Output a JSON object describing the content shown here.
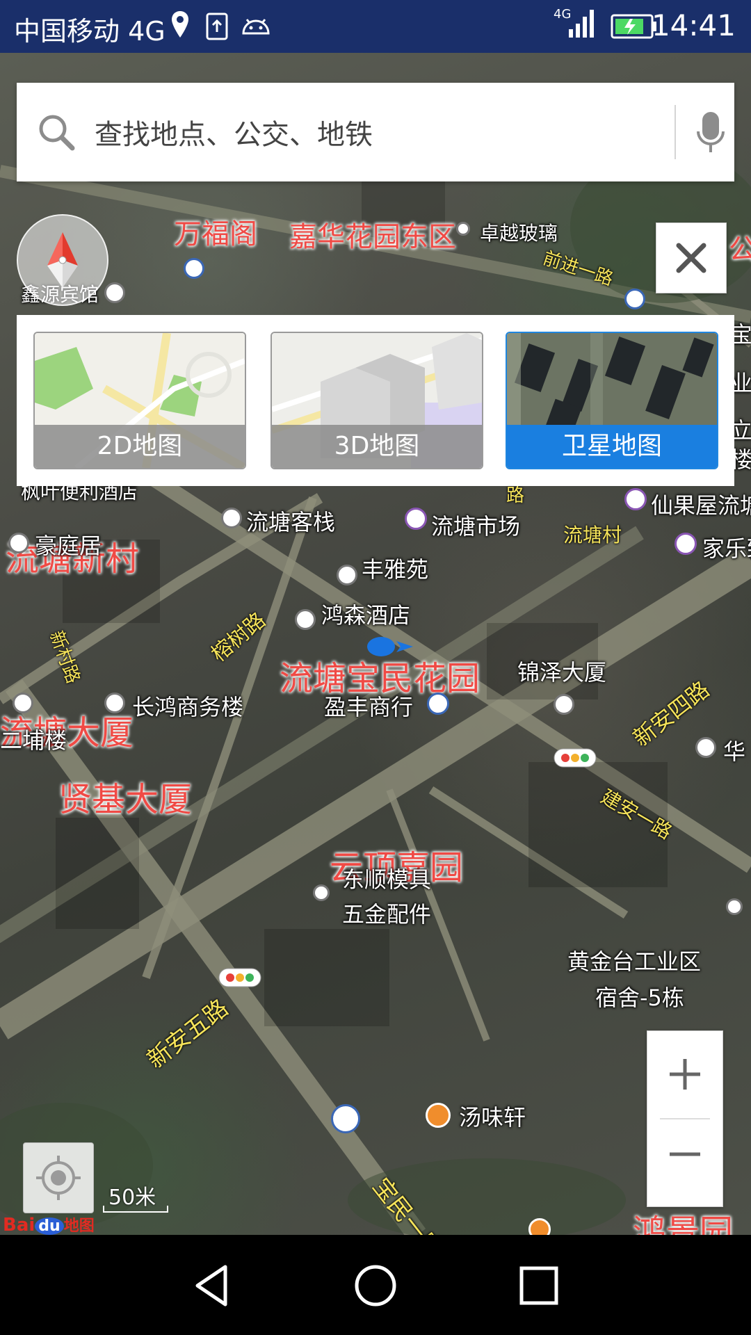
{
  "status_bar": {
    "carrier": "中国移动 4G",
    "network_badge": "4G",
    "time": "14:41",
    "icons": [
      "location-icon",
      "upload-icon",
      "android-icon",
      "signal-icon",
      "battery-icon"
    ]
  },
  "search": {
    "placeholder": "查找地点、公交、地铁",
    "icons": [
      "search-icon",
      "microphone-icon"
    ]
  },
  "layer_panel": {
    "options": [
      {
        "label": "2D地图",
        "selected": false
      },
      {
        "label": "3D地图",
        "selected": false
      },
      {
        "label": "卫星地图",
        "selected": true
      }
    ],
    "accent_color": "#1a7fe0"
  },
  "map": {
    "labels_red_large": [
      "流塘新村",
      "流塘宝民花园",
      "流塘大厦",
      "贤基大厦",
      "云顶嘉园",
      "鸿景园"
    ],
    "labels_red": [
      "万福阁",
      "嘉华花园东区",
      "公"
    ],
    "labels_white": [
      "卓越玻璃",
      "鑫源宾馆",
      "枫叶便利酒店",
      "流塘客栈",
      "流塘市场",
      "仙果屋流塘",
      "豪庭居",
      "家乐致",
      "丰雅苑",
      "鸿森酒店",
      "锦泽大厦",
      "长鸿商务楼",
      "盈丰商行",
      "华",
      "二埔楼",
      "东顺模具",
      "五金配件",
      "黄金台工业区",
      "宿舍-5栋",
      "汤味轩",
      "宝",
      "业",
      "立",
      "楼"
    ],
    "labels_road": [
      "前进一路",
      "榕树路",
      "新村路",
      "流塘村",
      "新安四路",
      "建安一路",
      "新安五路",
      "宝民一路",
      "路"
    ],
    "scale": "50米",
    "logo_text": "Bai",
    "logo_du": "du",
    "logo_suffix": "地图"
  },
  "nav": {
    "icons": [
      "back-icon",
      "home-icon",
      "recents-icon"
    ]
  }
}
